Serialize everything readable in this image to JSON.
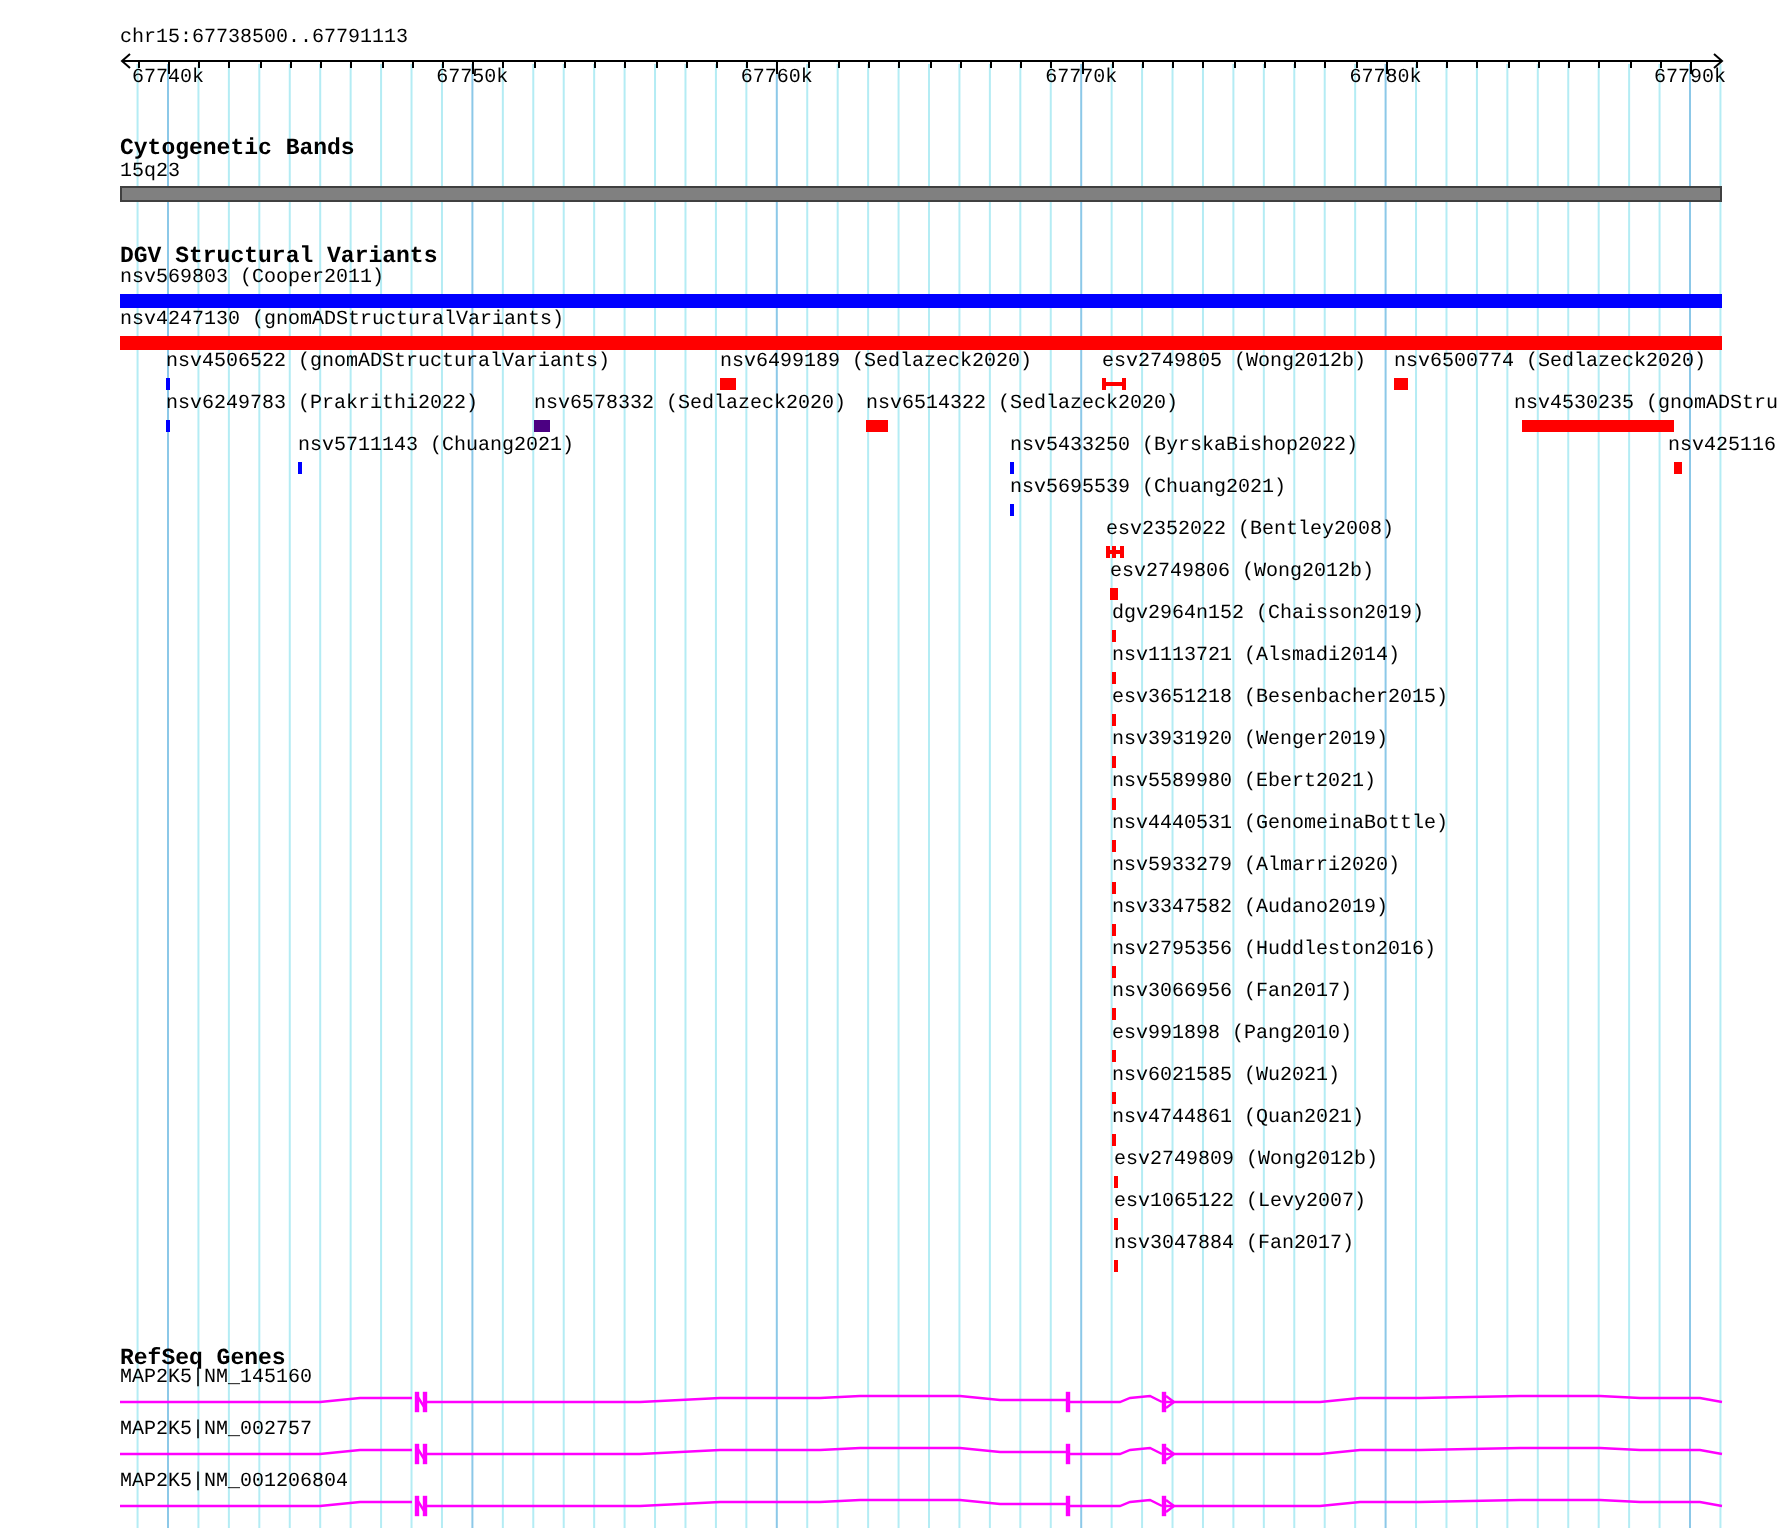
{
  "ruler": {
    "region": "chr15:67738500..67791113",
    "ticks": [
      "67740k",
      "67750k",
      "67760k",
      "67770k",
      "67780k",
      "67790k"
    ]
  },
  "tracks": [
    {
      "kind": "bands",
      "title": "Cytogenetic Bands",
      "features": [
        {
          "label": "15q23",
          "color": "#808080"
        }
      ]
    },
    {
      "kind": "variants",
      "title": "DGV Structural Variants",
      "features": [
        {
          "label": "nsv569803 (Cooper2011)",
          "color": "#0000ff",
          "kind": "block"
        },
        {
          "label": "nsv4247130 (gnomADStructuralVariants)",
          "color": "#ff0000",
          "kind": "block"
        },
        {
          "label": "nsv4506522 (gnomADStructuralVariants)",
          "color": "#0000ff",
          "kind": "block"
        },
        {
          "label": "nsv6499189 (Sedlazeck2020)",
          "color": "#ff0000",
          "kind": "block"
        },
        {
          "label": "esv2749805 (Wong2012b)",
          "color": "#ff0000",
          "kind": "span"
        },
        {
          "label": "nsv6500774 (Sedlazeck2020)",
          "color": "#ff0000",
          "kind": "block"
        },
        {
          "label": "nsv6249783 (Prakrithi2022)",
          "color": "#0000ff",
          "kind": "block"
        },
        {
          "label": "nsv6578332 (Sedlazeck2020)",
          "color": "#4b0082",
          "kind": "block"
        },
        {
          "label": "nsv6514322 (Sedlazeck2020)",
          "color": "#ff0000",
          "kind": "block"
        },
        {
          "label": "nsv4530235 (gnomADStru",
          "color": "#ff0000",
          "kind": "block"
        },
        {
          "label": "nsv5711143 (Chuang2021)",
          "color": "#0000ff",
          "kind": "block"
        },
        {
          "label": "nsv5433250 (ByrskaBishop2022)",
          "color": "#0000ff",
          "kind": "block"
        },
        {
          "label": "nsv425116",
          "color": "#ff0000",
          "kind": "block"
        },
        {
          "label": "nsv5695539 (Chuang2021)",
          "color": "#0000ff",
          "kind": "block"
        },
        {
          "label": "esv2352022 (Bentley2008)",
          "color": "#ff0000",
          "kind": "double_span"
        },
        {
          "label": "esv2749806 (Wong2012b)",
          "color": "#ff0000",
          "kind": "block"
        },
        {
          "label": "dgv2964n152 (Chaisson2019)",
          "color": "#ff0000",
          "kind": "block"
        },
        {
          "label": "nsv1113721 (Alsmadi2014)",
          "color": "#ff0000",
          "kind": "block"
        },
        {
          "label": "esv3651218 (Besenbacher2015)",
          "color": "#ff0000",
          "kind": "block"
        },
        {
          "label": "nsv3931920 (Wenger2019)",
          "color": "#ff0000",
          "kind": "block"
        },
        {
          "label": "nsv5589980 (Ebert2021)",
          "color": "#ff0000",
          "kind": "block"
        },
        {
          "label": "nsv4440531 (GenomeinaBottle)",
          "color": "#ff0000",
          "kind": "block"
        },
        {
          "label": "nsv5933279 (Almarri2020)",
          "color": "#ff0000",
          "kind": "block"
        },
        {
          "label": "nsv3347582 (Audano2019)",
          "color": "#ff0000",
          "kind": "block"
        },
        {
          "label": "nsv2795356 (Huddleston2016)",
          "color": "#ff0000",
          "kind": "block"
        },
        {
          "label": "nsv3066956 (Fan2017)",
          "color": "#ff0000",
          "kind": "block"
        },
        {
          "label": "esv991898 (Pang2010)",
          "color": "#ff0000",
          "kind": "block"
        },
        {
          "label": "nsv6021585 (Wu2021)",
          "color": "#ff0000",
          "kind": "block"
        },
        {
          "label": "nsv4744861 (Quan2021)",
          "color": "#ff0000",
          "kind": "block"
        },
        {
          "label": "esv2749809 (Wong2012b)",
          "color": "#ff0000",
          "kind": "block"
        },
        {
          "label": "esv1065122 (Levy2007)",
          "color": "#ff0000",
          "kind": "block"
        },
        {
          "label": "nsv3047884 (Fan2017)",
          "color": "#ff0000",
          "kind": "block"
        }
      ]
    },
    {
      "kind": "genes",
      "title": "RefSeq Genes",
      "features": [
        {
          "label": "MAP2K5|NM_145160",
          "color": "#ff00ff",
          "kind": "transcript"
        },
        {
          "label": "MAP2K5|NM_002757",
          "color": "#ff00ff",
          "kind": "transcript"
        },
        {
          "label": "MAP2K5|NM_001206804",
          "color": "#ff00ff",
          "kind": "transcript"
        }
      ]
    }
  ]
}
